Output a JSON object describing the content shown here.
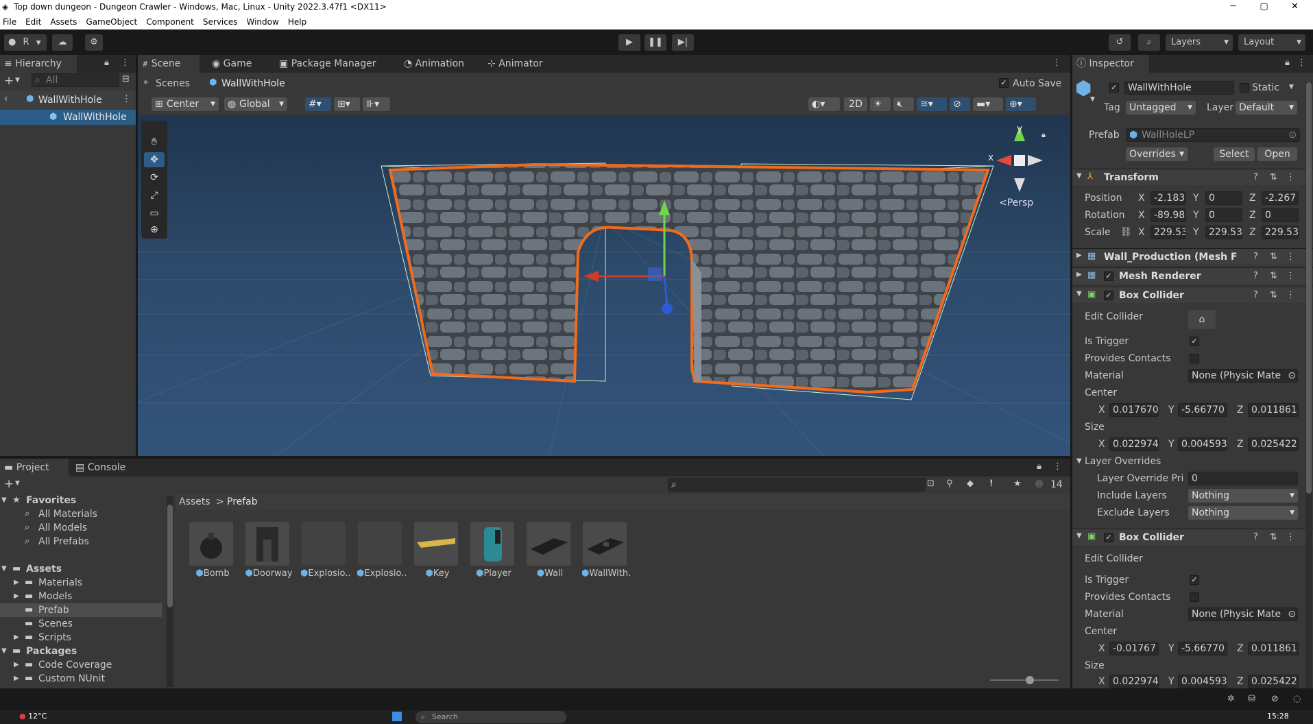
{
  "window": {
    "title": "Top down dungeon - Dungeon Crawler - Windows, Mac, Linux - Unity 2022.3.47f1 <DX11>",
    "controls": [
      "─",
      "▢",
      "✕"
    ]
  },
  "menu": [
    "File",
    "Edit",
    "Assets",
    "GameObject",
    "Component",
    "Services",
    "Window",
    "Help"
  ],
  "toolbar": {
    "account_label": "R",
    "layers_label": "Layers",
    "layout_label": "Layout"
  },
  "hierarchy": {
    "tab": "Hierarchy",
    "search_placeholder": "All",
    "root": "WallWithHole",
    "child": "WallWithHole"
  },
  "scene": {
    "tabs": [
      "Scene",
      "Game",
      "Package Manager",
      "Animation",
      "Animator"
    ],
    "breadcrumb_root": "Scenes",
    "breadcrumb_item": "WallWithHole",
    "auto_save": "Auto Save",
    "pivot": "Center",
    "space": "Global",
    "mode_2d": "2D",
    "persp": "Persp",
    "gizmo_y": "y",
    "gizmo_x": "x"
  },
  "inspector": {
    "tab": "Inspector",
    "object_name": "WallWithHole",
    "static_label": "Static",
    "tag_label": "Tag",
    "tag_value": "Untagged",
    "layer_label": "Layer",
    "layer_value": "Default",
    "prefab_label": "Prefab",
    "prefab_value": "WallHoleLP",
    "overrides": "Overrides",
    "select": "Select",
    "open": "Open",
    "transform": {
      "title": "Transform",
      "position_label": "Position",
      "rotation_label": "Rotation",
      "scale_label": "Scale",
      "position": {
        "x": "-2.183",
        "y": "0",
        "z": "-2.267"
      },
      "rotation": {
        "x": "-89.98",
        "y": "0",
        "z": "0"
      },
      "scale": {
        "x": "229.53",
        "y": "229.53",
        "z": "229.53"
      }
    },
    "mesh_filter": "Wall_Production (Mesh F",
    "mesh_renderer": "Mesh Renderer",
    "box_collider_1": {
      "title": "Box Collider",
      "edit_collider": "Edit Collider",
      "is_trigger": "Is Trigger",
      "provides_contacts": "Provides Contacts",
      "material_label": "Material",
      "material_value": "None (Physic Mate",
      "center_label": "Center",
      "center": {
        "x": "0.017670",
        "y": "-5.66770",
        "z": "0.011861"
      },
      "size_label": "Size",
      "size": {
        "x": "0.022974",
        "y": "0.004593",
        "z": "0.025422"
      },
      "layer_overrides": "Layer Overrides",
      "layer_override_priority_label": "Layer Override Pri",
      "layer_override_priority_value": "0",
      "include_layers_label": "Include Layers",
      "include_layers_value": "Nothing",
      "exclude_layers_label": "Exclude Layers",
      "exclude_layers_value": "Nothing"
    },
    "box_collider_2": {
      "title": "Box Collider",
      "edit_collider": "Edit Collider",
      "is_trigger": "Is Trigger",
      "provides_contacts": "Provides Contacts",
      "material_label": "Material",
      "material_value": "None (Physic Mate",
      "center_label": "Center",
      "center": {
        "x": "-0.01767",
        "y": "-5.66770",
        "z": "0.011861"
      },
      "size_label": "Size",
      "size": {
        "x": "0.022974",
        "y": "0.004593",
        "z": "0.025422"
      }
    }
  },
  "project": {
    "tabs": [
      "Project",
      "Console"
    ],
    "hidden_count": "14",
    "favorites_label": "Favorites",
    "favorites": [
      "All Materials",
      "All Models",
      "All Prefabs"
    ],
    "assets_label": "Assets",
    "asset_folders": [
      "Materials",
      "Models",
      "Prefab",
      "Scenes",
      "Scripts"
    ],
    "packages_label": "Packages",
    "package_folders": [
      "Code Coverage",
      "Custom NUnit"
    ],
    "path_root": "Assets",
    "path_current": "Prefab",
    "items": [
      "Bomb",
      "Doorway",
      "Explosio...",
      "Explosio...",
      "Key",
      "Player",
      "Wall",
      "WallWith..."
    ]
  },
  "taskbar": {
    "weather": "12°C",
    "search_placeholder": "Search",
    "time": "15:28"
  },
  "colors": {
    "accent": "#3a79bb",
    "panel": "#383838",
    "dark": "#191919",
    "selection_outline": "#f26b1d"
  }
}
